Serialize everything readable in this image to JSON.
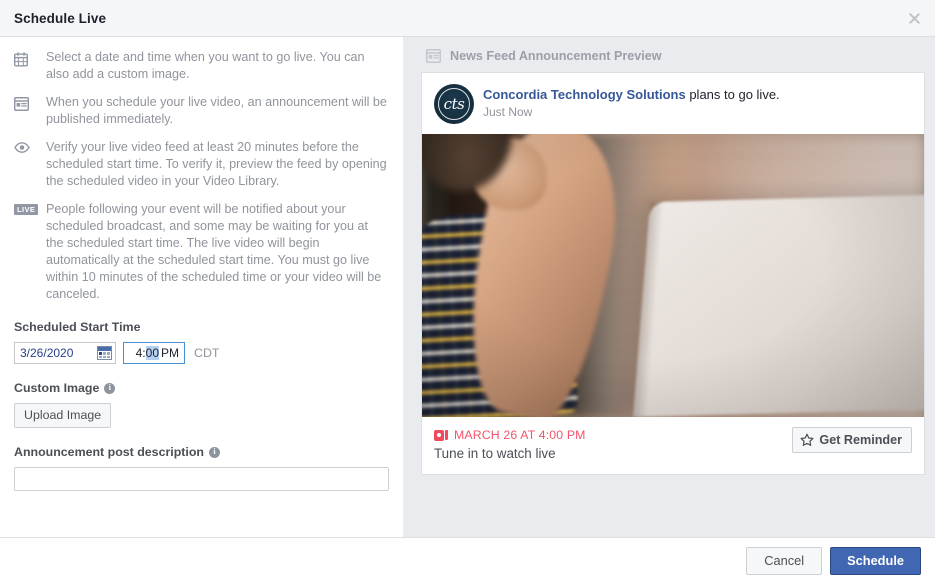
{
  "dialog": {
    "title": "Schedule Live",
    "close_icon": "close-icon"
  },
  "info_list": [
    {
      "icon": "calendar-icon",
      "text": "Select a date and time when you want to go live. You can also add a custom image."
    },
    {
      "icon": "news-feed-icon",
      "text": "When you schedule your live video, an announcement will be published immediately."
    },
    {
      "icon": "eye-icon",
      "text": "Verify your live video feed at least 20 minutes before the scheduled start time. To verify it, preview the feed by opening the scheduled video in your Video Library."
    },
    {
      "icon": "live-badge-icon",
      "badge": "LIVE",
      "text": "People following your event will be notified about your scheduled broadcast, and some may be waiting for you at the scheduled start time. The live video will begin automatically at the scheduled start time. You must go live within 10 minutes of the scheduled time or your video will be canceled."
    }
  ],
  "form": {
    "scheduled_start_time_label": "Scheduled Start Time",
    "date_value": "3/26/2020",
    "date_calendar_icon": "calendar-picker-icon",
    "time_hour": "4",
    "time_colon": ":",
    "time_minutes": "00",
    "time_ampm": "PM",
    "timezone": "CDT",
    "custom_image_label": "Custom Image",
    "custom_image_info_icon": "info-icon",
    "upload_image_label": "Upload Image",
    "description_label": "Announcement post description",
    "description_info_icon": "info-icon",
    "description_value": "",
    "description_placeholder": ""
  },
  "preview": {
    "header_icon": "news-feed-icon",
    "header_title": "News Feed Announcement Preview",
    "post": {
      "avatar_text": "cts",
      "avatar_name": "concordia-technology-solutions-avatar",
      "page_name": "Concordia Technology Solutions",
      "action_text": " plans to go live.",
      "timestamp": "Just Now",
      "image_alt": "person in plaid shirt at laptop near window",
      "live_icon": "video-camera-icon",
      "live_when": "MARCH 26 AT 4:00 PM",
      "tune_in_text": "Tune in to watch live",
      "reminder_icon": "star-icon",
      "reminder_label": "Get Reminder"
    }
  },
  "footer": {
    "cancel_label": "Cancel",
    "schedule_label": "Schedule"
  },
  "colors": {
    "accent_blue": "#4267b2",
    "link_blue": "#365899",
    "live_red": "#f3546b",
    "muted_text": "#90949c",
    "panel_gray": "#e9ebee",
    "titlebar_gray": "#f5f6f7",
    "date_text_blue": "#27408b",
    "time_selection_blue": "#b5d0f0"
  }
}
